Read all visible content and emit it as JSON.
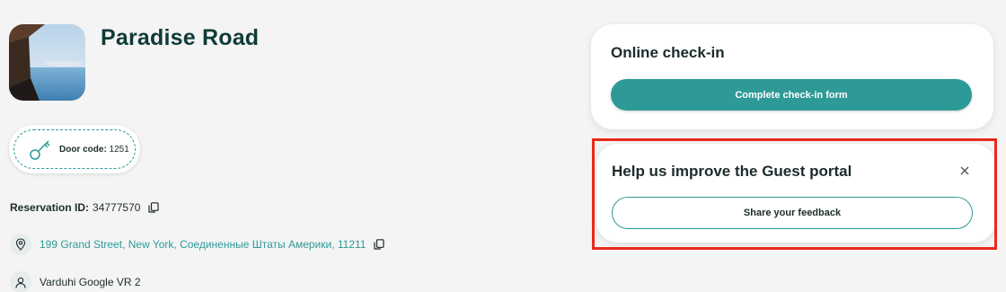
{
  "property": {
    "name": "Paradise Road",
    "image_icon": "property-photo"
  },
  "door_code": {
    "label": "Door code:",
    "value": "1251",
    "icon": "key-icon"
  },
  "reservation": {
    "label": "Reservation ID:",
    "value": "34777570",
    "copy_icon": "copy-icon"
  },
  "address": {
    "text": "199 Grand Street, New York, Соединенные Штаты Америки, 11211",
    "icon": "location-pin-icon",
    "copy_icon": "copy-icon"
  },
  "host": {
    "name": "Varduhi Google VR 2",
    "icon": "person-icon"
  },
  "checkin_card": {
    "title": "Online check-in",
    "button_label": "Complete check-in form"
  },
  "feedback_card": {
    "title": "Help us improve the Guest portal",
    "button_label": "Share your feedback",
    "close_icon": "close-icon"
  },
  "colors": {
    "accent": "#2e9a98",
    "title": "#0f3b38",
    "highlight": "#e8291c",
    "background": "#f4f4f4"
  }
}
